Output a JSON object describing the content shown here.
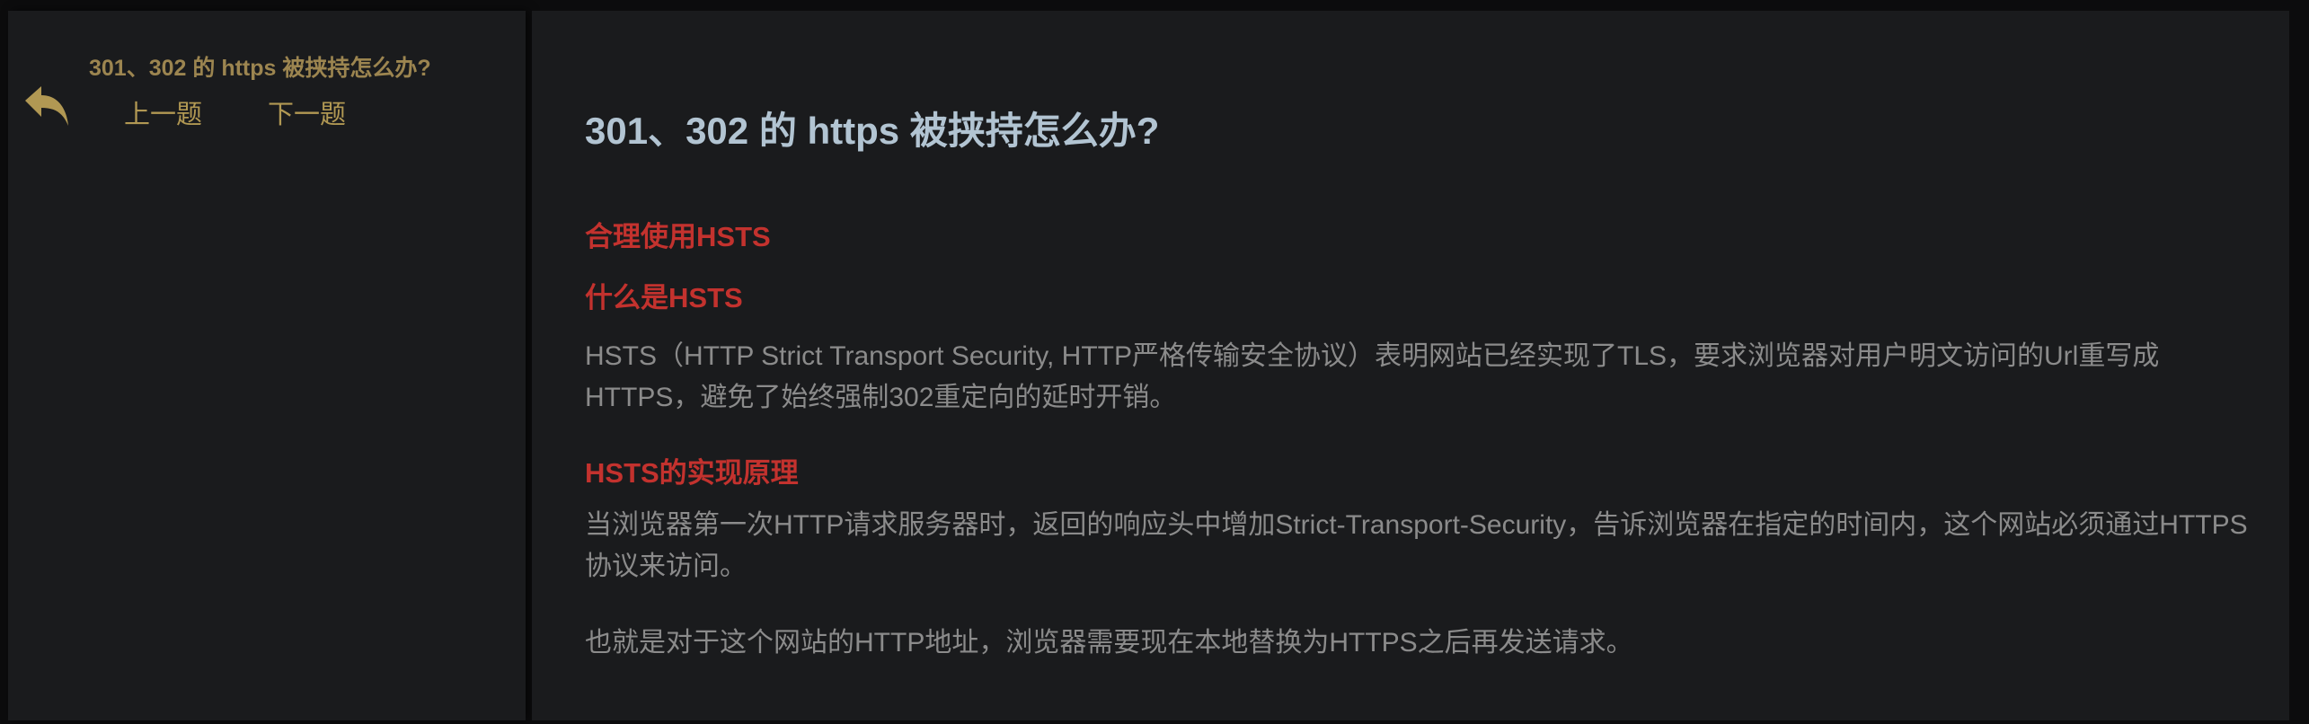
{
  "sidebar": {
    "title": "301、302 的 https 被挟持怎么办?",
    "prev_label": "上一题",
    "next_label": "下一题",
    "back_icon": "reply-arrow-icon"
  },
  "article": {
    "title": "301、302 的 https 被挟持怎么办?",
    "sections": [
      {
        "heading": "合理使用HSTS"
      },
      {
        "heading": "什么是HSTS",
        "paragraph": "HSTS（HTTP Strict Transport Security, HTTP严格传输安全协议）表明网站已经实现了TLS，要求浏览器对用户明文访问的Url重写成HTTPS，避免了始终强制302重定向的延时开销。"
      },
      {
        "heading": "HSTS的实现原理",
        "paragraphs": [
          "当浏览器第一次HTTP请求服务器时，返回的响应头中增加Strict-Transport-Security，告诉浏览器在指定的时间内，这个网站必须通过HTTPS协议来访问。",
          "也就是对于这个网站的HTTP地址，浏览器需要现在本地替换为HTTPS之后再发送请求。"
        ]
      }
    ]
  },
  "colors": {
    "heading_red": "#c3322e",
    "title": "#b2c4d2",
    "gold": "#b19853"
  }
}
